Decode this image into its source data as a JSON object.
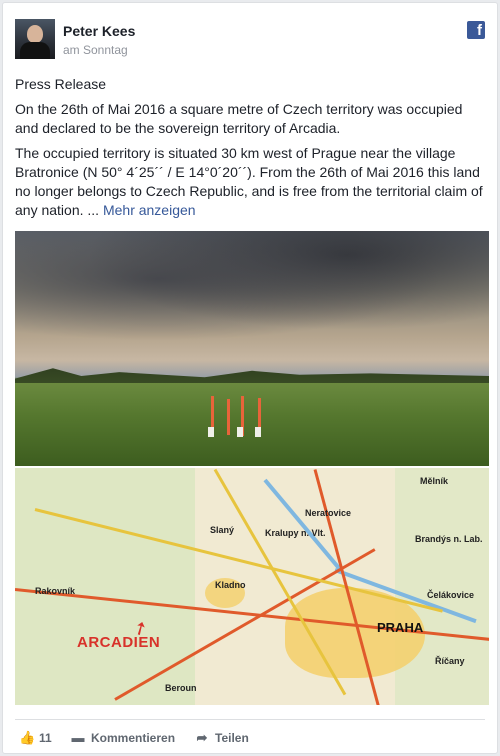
{
  "post": {
    "author": "Peter Kees",
    "time": "am Sonntag",
    "network_icon": "facebook-icon",
    "paragraphs": [
      "Press Release",
      "On the 26th of Mai 2016 a square metre of Czech territory was occupied and declared to be the sovereign territory of Arcadia.",
      "The occupied territory is situated 30 km west of Prague near the village Bratronice (N 50° 4´25´´ / E 14°0´20´´). From the 26th of Mai 2016 this land no longer belongs to Czech Republic, and is free from the territorial claim of any nation. ..."
    ],
    "more_link": "Mehr anzeigen"
  },
  "map": {
    "city_label": "PRAHA",
    "marker_label": "ARCADIEN",
    "labels": [
      "Slaný",
      "Kladno",
      "Neratovice",
      "Kralupy n. Vlt.",
      "Beroun",
      "Rakovník",
      "Říčany",
      "Čelákovice",
      "Brandýs n. Lab.",
      "Mělník"
    ]
  },
  "actions": {
    "like_count": "11",
    "comment_label": "Kommentieren",
    "share_label": "Teilen"
  },
  "colors": {
    "facebook_blue": "#3b5998",
    "link": "#365899",
    "map_marker": "#d8322a"
  }
}
